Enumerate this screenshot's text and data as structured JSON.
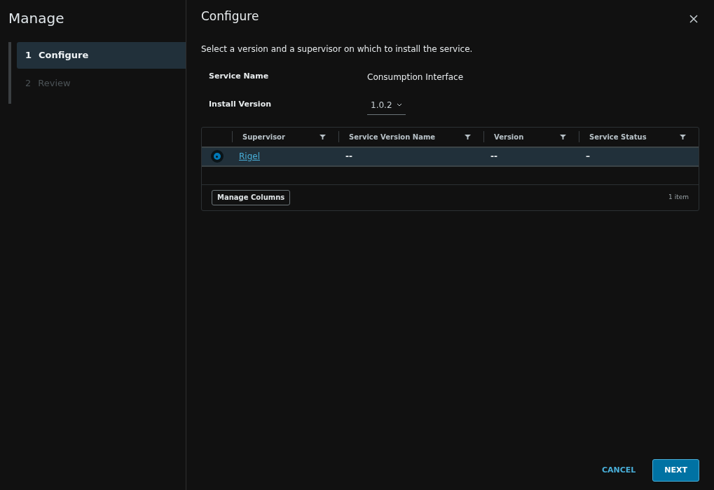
{
  "sidebar": {
    "title": "Manage",
    "steps": [
      {
        "number": "1",
        "label": "Configure",
        "selected": true
      },
      {
        "number": "2",
        "label": "Review",
        "selected": false
      }
    ]
  },
  "main": {
    "title": "Configure",
    "description": "Select a version and a supervisor on which to install the service.",
    "fields": [
      {
        "kind": "text",
        "label": "Service Name",
        "value": "Consumption Interface"
      },
      {
        "kind": "select",
        "label": "Install Version",
        "value": "1.0.2"
      }
    ],
    "table": {
      "columns": [
        "Supervisor",
        "Service Version Name",
        "Version",
        "Service Status"
      ],
      "rows": [
        {
          "selected": true,
          "cells": [
            "Rigel",
            "--",
            "--",
            "–"
          ]
        }
      ],
      "manage_columns": "Manage Columns",
      "count": "1 item"
    }
  },
  "footer": {
    "buttons": [
      {
        "kind": "flat",
        "label": "CANCEL"
      },
      {
        "kind": "primary",
        "label": "NEXT"
      }
    ]
  }
}
